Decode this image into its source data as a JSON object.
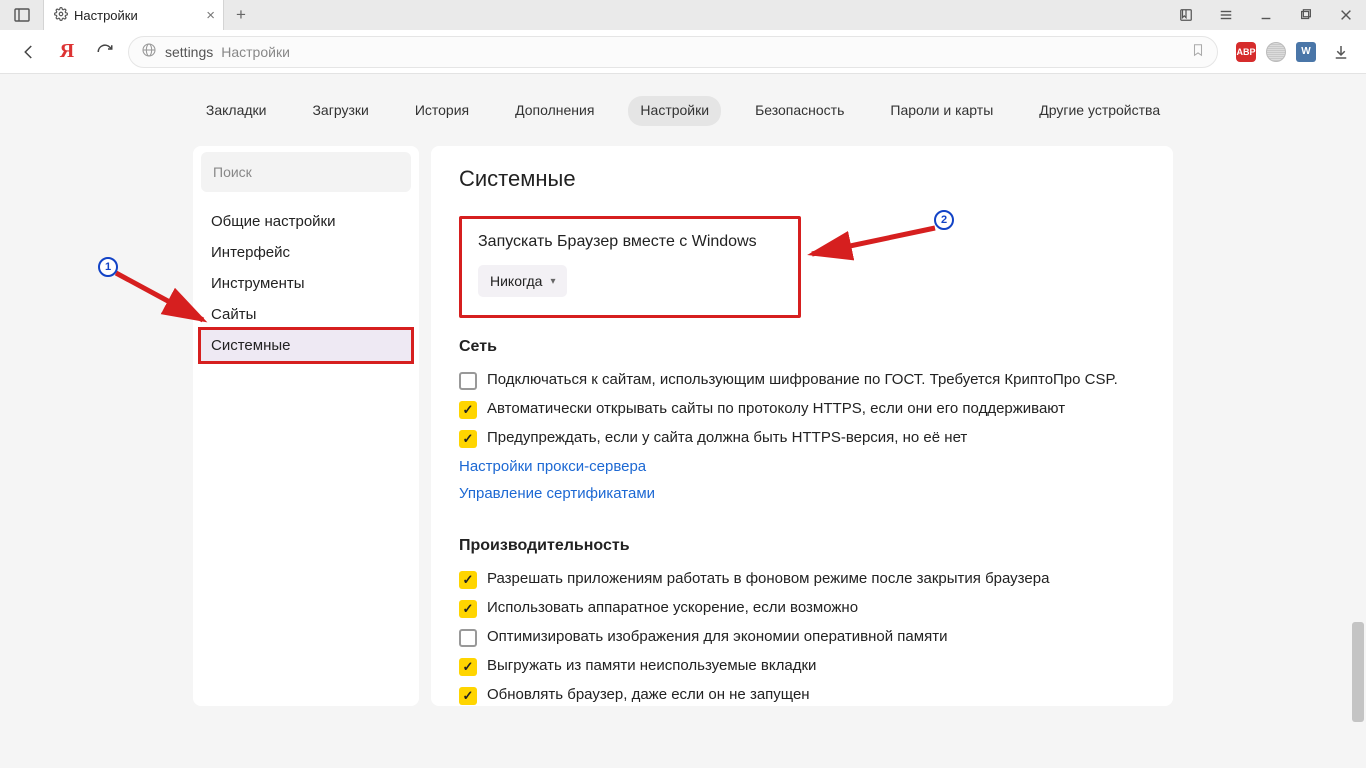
{
  "tab": {
    "title": "Настройки"
  },
  "omnibox": {
    "prefix": "settings",
    "page": "Настройки"
  },
  "nav": {
    "items": [
      {
        "label": "Закладки"
      },
      {
        "label": "Загрузки"
      },
      {
        "label": "История"
      },
      {
        "label": "Дополнения"
      },
      {
        "label": "Настройки",
        "active": true
      },
      {
        "label": "Безопасность"
      },
      {
        "label": "Пароли и карты"
      },
      {
        "label": "Другие устройства"
      }
    ]
  },
  "sidebar": {
    "search_placeholder": "Поиск",
    "items": [
      {
        "label": "Общие настройки"
      },
      {
        "label": "Интерфейс"
      },
      {
        "label": "Инструменты"
      },
      {
        "label": "Сайты"
      },
      {
        "label": "Системные",
        "active": true
      }
    ]
  },
  "content": {
    "title": "Системные",
    "boot": {
      "title": "Запускать Браузер вместе с Windows",
      "dropdown_value": "Никогда"
    },
    "network": {
      "heading": "Сеть",
      "options": [
        {
          "label": "Подключаться к сайтам, использующим шифрование по ГОСТ. Требуется КриптоПро CSP.",
          "checked": false
        },
        {
          "label": "Автоматически открывать сайты по протоколу HTTPS, если они его поддерживают",
          "checked": true
        },
        {
          "label": "Предупреждать, если у сайта должна быть HTTPS-версия, но её нет",
          "checked": true
        }
      ],
      "links": [
        {
          "label": "Настройки прокси-сервера"
        },
        {
          "label": "Управление сертификатами"
        }
      ]
    },
    "performance": {
      "heading": "Производительность",
      "options": [
        {
          "label": "Разрешать приложениям работать в фоновом режиме после закрытия браузера",
          "checked": true
        },
        {
          "label": "Использовать аппаратное ускорение, если возможно",
          "checked": true
        },
        {
          "label": "Оптимизировать изображения для экономии оперативной памяти",
          "checked": false
        },
        {
          "label": "Выгружать из памяти неиспользуемые вкладки",
          "checked": true
        },
        {
          "label": "Обновлять браузер, даже если он не запущен",
          "checked": true
        }
      ]
    }
  },
  "annotations": {
    "badge1": "1",
    "badge2": "2"
  },
  "ext": {
    "abp": "ABP",
    "vk": "W"
  }
}
